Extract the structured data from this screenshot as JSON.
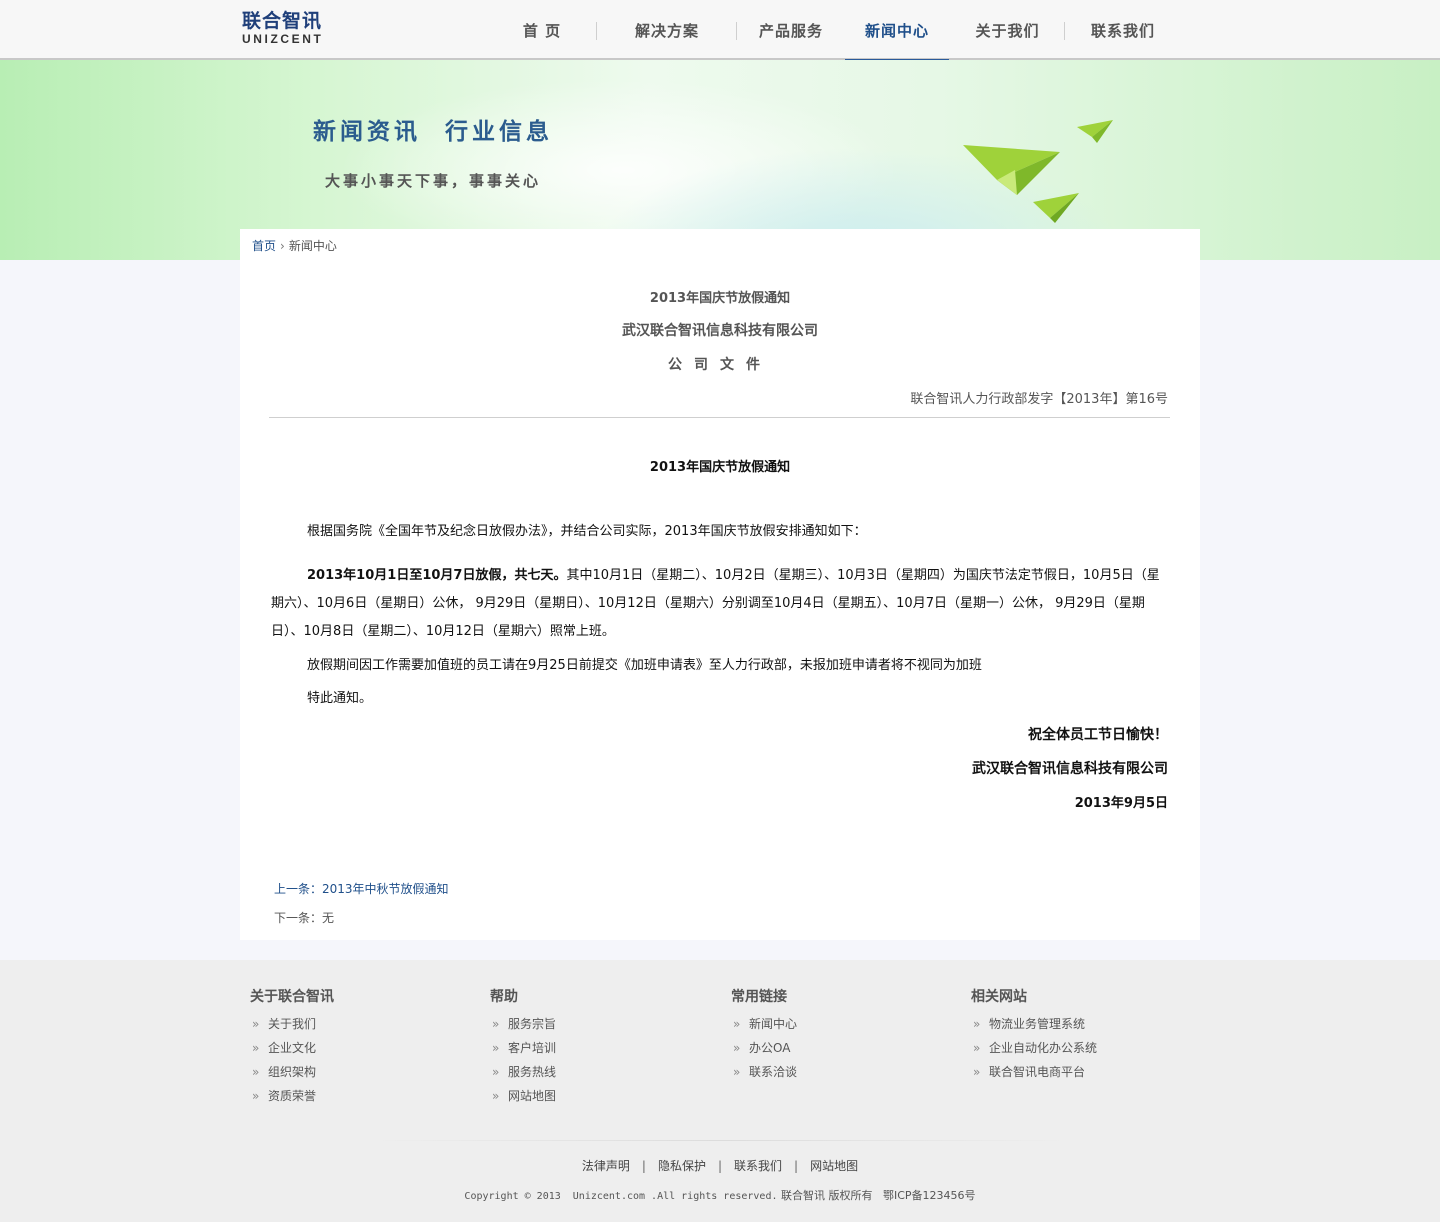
{
  "header": {
    "logo_cn": "联合智讯",
    "logo_en": "UNIZCENT",
    "nav": [
      {
        "label": "首 页",
        "active": false
      },
      {
        "label": "解决方案",
        "active": false
      },
      {
        "label": "产品服务",
        "active": false
      },
      {
        "label": "新闻中心",
        "active": true
      },
      {
        "label": "关于我们",
        "active": false
      },
      {
        "label": "联系我们",
        "active": false
      }
    ]
  },
  "banner": {
    "title": "新闻资讯  行业信息",
    "subtitle": "大事小事天下事，事事关心"
  },
  "breadcrumb": {
    "home": "首页",
    "current": "新闻中心"
  },
  "article": {
    "header_title": "2013年国庆节放假通知",
    "company": "武汉联合智讯信息科技有限公司",
    "doc_type": "公司文件",
    "doc_number": "联合智讯人力行政部发字【2013年】第16号",
    "body_title": "2013年国庆节放假通知",
    "para1": "根据国务院《全国年节及纪念日放假办法》，并结合公司实际，2013年国庆节放假安排通知如下：",
    "para2_bold": "2013年10月1日至10月7日放假，共七天。",
    "para2_rest": "其中10月1日（星期二）、10月2日（星期三）、10月3日（星期四）为国庆节法定节假日，10月5日（星期六）、10月6日（星期日）公休， 9月29日（星期日）、10月12日（星期六）分别调至10月4日（星期五）、10月7日（星期一）公休， 9月29日（星期日）、10月8日（星期二）、10月12日（星期六）照常上班。",
    "para3": "放假期间因工作需要加值班的员工请在9月25日前提交《加班申请表》至人力行政部，未报加班申请者将不视同为加班",
    "para4": "特此通知。",
    "greeting": "祝全体员工节日愉快！",
    "signature": "武汉联合智讯信息科技有限公司",
    "date": "2013年9月5日",
    "prev": "上一条：2013年中秋节放假通知",
    "next": "下一条：无"
  },
  "footer": {
    "columns": [
      {
        "title": "关于联合智讯",
        "items": [
          "关于我们",
          "企业文化",
          "组织架构",
          "资质荣誉"
        ]
      },
      {
        "title": "帮助",
        "items": [
          "服务宗旨",
          "客户培训",
          "服务热线",
          "网站地图"
        ]
      },
      {
        "title": "常用链接",
        "items": [
          "新闻中心",
          "办公OA",
          "联系洽谈"
        ]
      },
      {
        "title": "相关网站",
        "items": [
          "物流业务管理系统",
          "企业自动化办公系统",
          "联合智讯电商平台"
        ]
      }
    ],
    "links": [
      "法律声明",
      "隐私保护",
      "联系我们",
      "网站地图"
    ],
    "copyright": "Copyright © 2013  Unizcent.com .All rights reserved.",
    "rights": "联合智讯 版权所有",
    "icp": "鄂ICP备123456号"
  },
  "colors": {
    "brand_blue": "#1f4f8a",
    "banner_green": "#b8eeb4",
    "footer_bg": "#eeeeee"
  }
}
